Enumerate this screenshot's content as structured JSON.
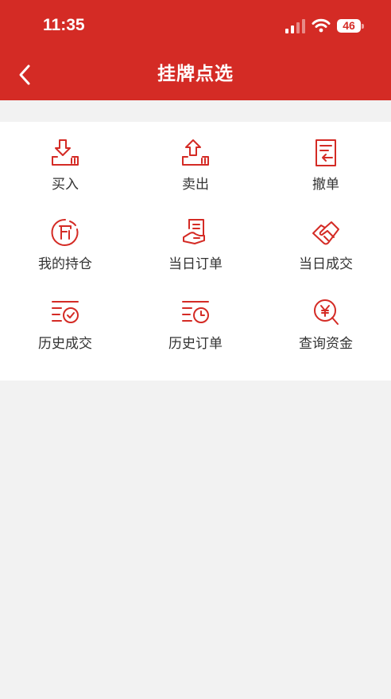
{
  "status_bar": {
    "time": "11:35",
    "battery": "46"
  },
  "nav": {
    "title": "挂牌点选"
  },
  "colors": {
    "primary": "#d42b25",
    "background": "#f2f2f2",
    "text": "#333333"
  },
  "menu": [
    {
      "label": "买入",
      "icon": "inbox-download-icon"
    },
    {
      "label": "卖出",
      "icon": "inbox-upload-icon"
    },
    {
      "label": "撤单",
      "icon": "document-return-icon"
    },
    {
      "label": "我的持仓",
      "icon": "position-circle-icon"
    },
    {
      "label": "当日订单",
      "icon": "order-hand-icon"
    },
    {
      "label": "当日成交",
      "icon": "handshake-icon"
    },
    {
      "label": "历史成交",
      "icon": "list-check-icon"
    },
    {
      "label": "历史订单",
      "icon": "list-clock-icon"
    },
    {
      "label": "查询资金",
      "icon": "yuan-search-icon"
    }
  ]
}
